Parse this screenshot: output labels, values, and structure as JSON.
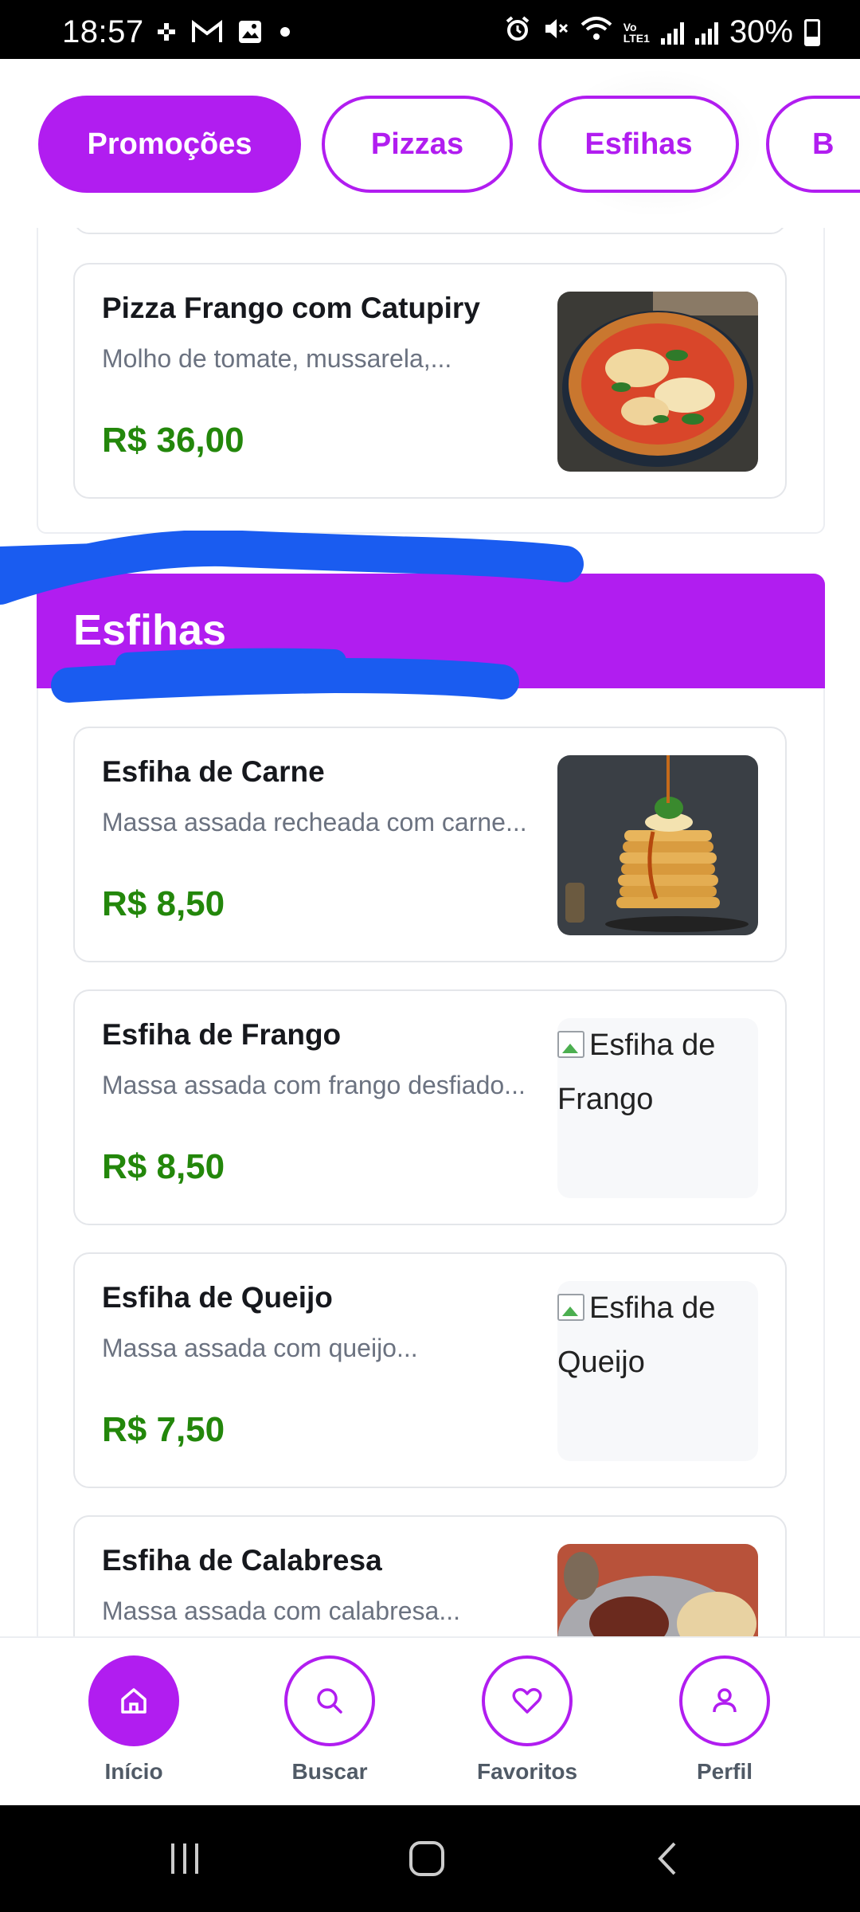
{
  "status_bar": {
    "time": "18:57",
    "battery": "30%",
    "icons": [
      "slack-icon",
      "gmail-icon",
      "gallery-icon",
      "dot-icon",
      "alarm-icon",
      "mute-icon",
      "wifi-icon",
      "volte-icon",
      "signal-icon",
      "signal-icon",
      "battery-icon"
    ]
  },
  "categories": [
    {
      "label": "Promoções",
      "active": true
    },
    {
      "label": "Pizzas",
      "active": false
    },
    {
      "label": "Esfihas",
      "active": false
    },
    {
      "label": "B",
      "active": false
    }
  ],
  "pizza_section": {
    "items": [
      {
        "name": "Pizza Frango com Catupiry",
        "description": "Molho de tomate, mussarela,...",
        "price": "R$ 36,00",
        "image": "pizza-photo"
      }
    ]
  },
  "esfiha_section": {
    "title": "Esfihas",
    "items": [
      {
        "name": "Esfiha de Carne",
        "description": "Massa assada recheada com carne...",
        "price": "R$ 8,50",
        "image": "pancake-stack-photo"
      },
      {
        "name": "Esfiha de Frango",
        "description": "Massa assada com frango desfiado...",
        "price": "R$ 8,50",
        "image_alt": "Esfiha de Frango"
      },
      {
        "name": "Esfiha de Queijo",
        "description": "Massa assada com queijo...",
        "price": "R$ 7,50",
        "image_alt": "Esfiha de Queijo"
      },
      {
        "name": "Esfiha de Calabresa",
        "description": "Massa assada com calabresa...",
        "price": "",
        "image": "flatbread-plate-photo"
      }
    ]
  },
  "bottom_nav": [
    {
      "label": "Início",
      "icon": "home-icon",
      "active": true
    },
    {
      "label": "Buscar",
      "icon": "search-icon",
      "active": false
    },
    {
      "label": "Favoritos",
      "icon": "heart-icon",
      "active": false
    },
    {
      "label": "Perfil",
      "icon": "user-icon",
      "active": false
    }
  ],
  "system_nav": [
    "recents-icon",
    "home-button-icon",
    "back-icon"
  ],
  "colors": {
    "accent": "#b11df0",
    "price": "#23870b",
    "scribble": "#1a5cf0"
  }
}
